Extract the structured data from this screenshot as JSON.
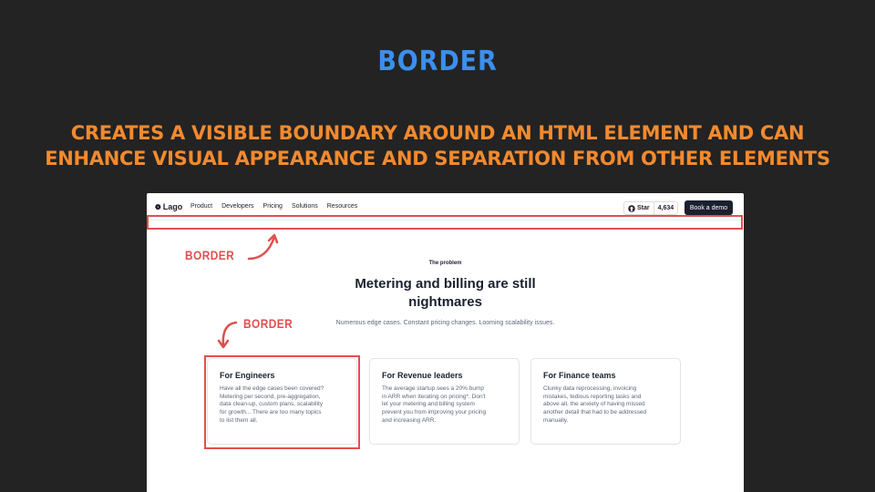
{
  "slide": {
    "title": "BORDER",
    "subtitle_line1": "CREATES A VISIBLE BOUNDARY AROUND AN HTML ELEMENT AND CAN",
    "subtitle_line2": "ENHANCE VISUAL APPEARANCE AND SEPARATION FROM OTHER ELEMENTS",
    "annotation_1": "BORDER",
    "annotation_2": "BORDER",
    "highlight_color": "#e0504f",
    "title_color": "#3b8fee",
    "subtitle_color": "#f28a2f"
  },
  "site": {
    "logo": "Lago",
    "logo_icon": "lago-logo-icon",
    "nav": [
      "Product",
      "Developers",
      "Pricing",
      "Solutions",
      "Resources"
    ],
    "star_label": "Star",
    "star_icon": "github-icon",
    "star_count": "4,634",
    "cta": "Book a demo"
  },
  "hero": {
    "eyebrow": "The problem",
    "heading_line1": "Metering and billing are still",
    "heading_line2": "nightmares",
    "subheading": "Numerous edge cases. Constant pricing changes. Looming scalability issues."
  },
  "cards": [
    {
      "title": "For Engineers",
      "lines": [
        "Have all the edge cases been covered?",
        "Metering per second, pre-aggregation,",
        "data clean-up, custom plans, scalability",
        "for growth... There are too many topics",
        "to list them all."
      ]
    },
    {
      "title": "For Revenue leaders",
      "lines": [
        "The average startup sees a 20% bump",
        "in ARR when iterating on pricing*. Don't",
        "let your metering and billing system",
        "prevent you from improving your pricing",
        "and increasing ARR."
      ]
    },
    {
      "title": "For Finance teams",
      "lines": [
        "Clunky data reprocessing, invoicing",
        "mistakes, tedious reporting tasks and",
        "above all, the anxiety of having missed",
        "another detail that had to be addressed",
        "manually."
      ]
    }
  ]
}
